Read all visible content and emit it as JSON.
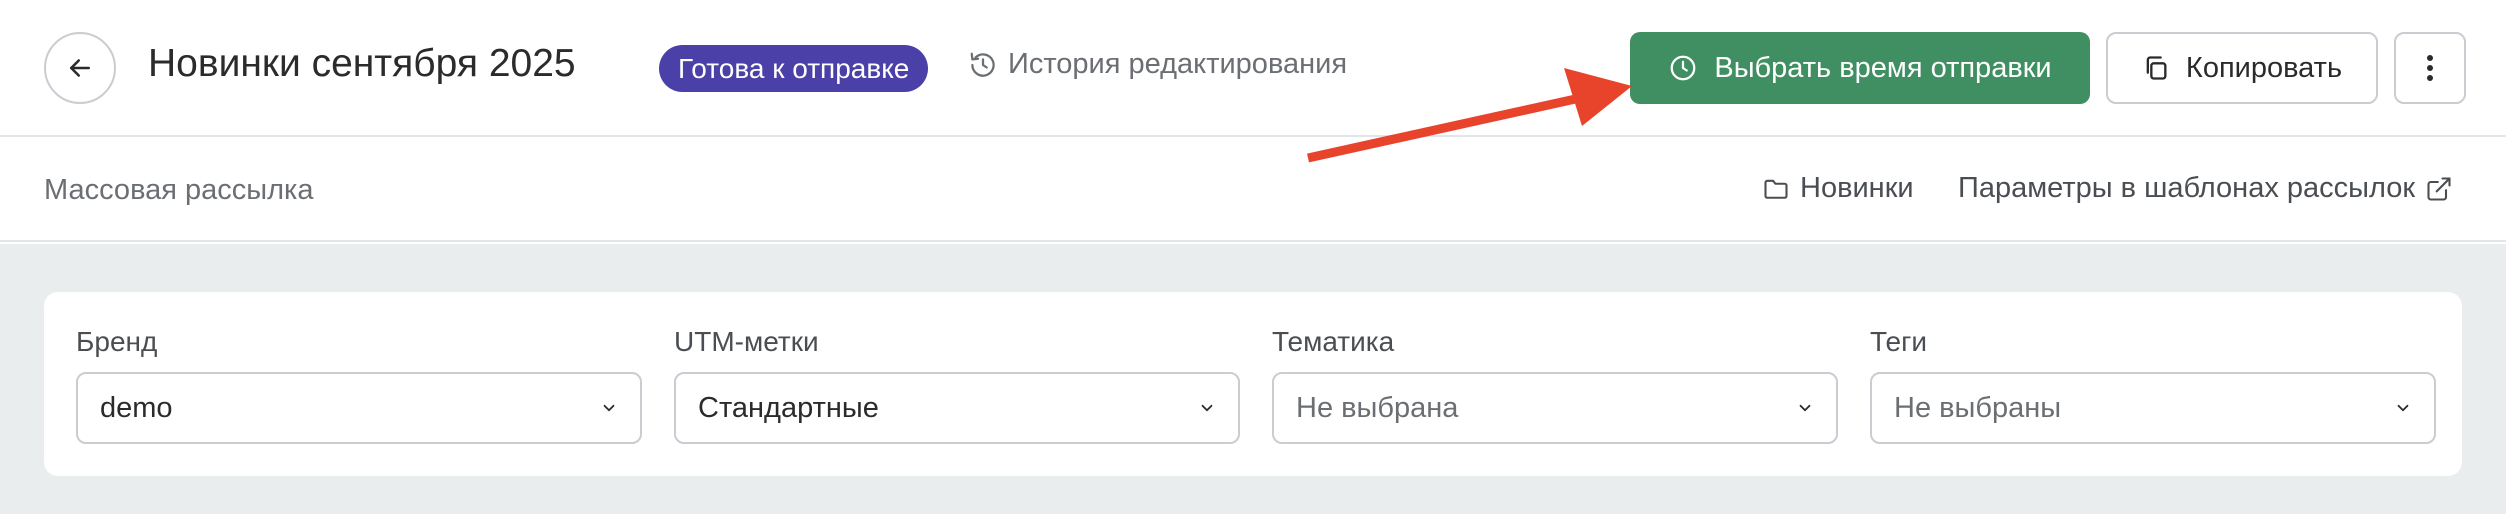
{
  "header": {
    "title": "Новинки сентября 2025",
    "status_badge": "Готова к отправке",
    "history_link": "История редактирования",
    "schedule_button": "Выбрать время отправки",
    "copy_button": "Копировать"
  },
  "subbar": {
    "type_label": "Массовая рассылка",
    "folder_link": "Новинки",
    "params_link": "Параметры в шаблонах рассылок"
  },
  "filters": [
    {
      "label": "Бренд",
      "value": "demo"
    },
    {
      "label": "UTM-метки",
      "value": "Стандартные"
    },
    {
      "label": "Тематика",
      "value": "Не выбрана"
    },
    {
      "label": "Теги",
      "value": "Не выбраны"
    }
  ],
  "colors": {
    "accent_green": "#3f8f62",
    "badge_purple": "#4b3fa8",
    "annotation_arrow": "#e8432b",
    "content_background": "#e9edee"
  },
  "icons": {
    "back": "arrow-left-icon",
    "history": "history-clock-icon",
    "schedule": "clock-icon",
    "copy": "copy-icon",
    "more": "vertical-dots-icon",
    "folder": "folder-icon",
    "external": "external-link-icon",
    "dropdown": "chevron-down-icon"
  }
}
